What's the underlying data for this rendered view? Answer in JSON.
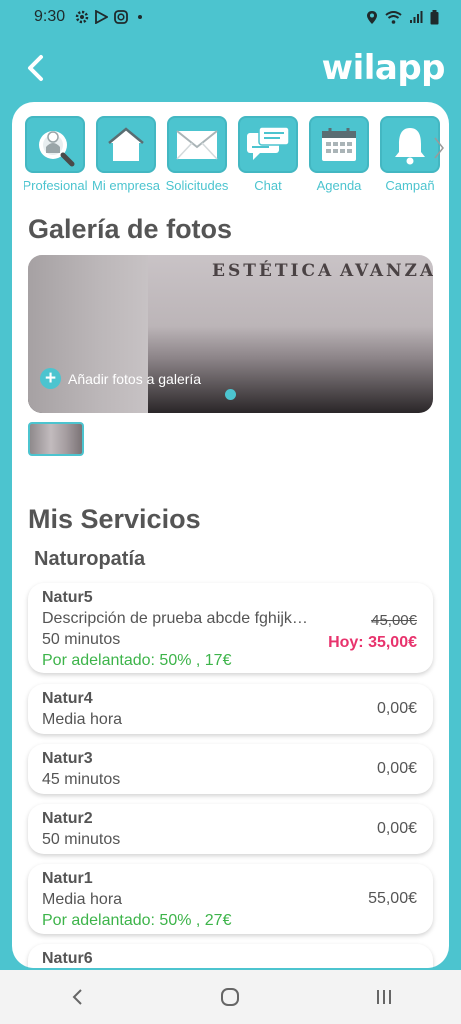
{
  "status_bar": {
    "time": "9:30"
  },
  "header": {
    "logo": "wilapp"
  },
  "menu": {
    "items": [
      {
        "label": "Profesional",
        "icon": "professional-search-icon"
      },
      {
        "label": "Mi empresa",
        "icon": "home-icon"
      },
      {
        "label": "Solicitudes",
        "icon": "envelope-icon"
      },
      {
        "label": "Chat",
        "icon": "chat-bubbles-icon"
      },
      {
        "label": "Agenda",
        "icon": "calendar-icon"
      },
      {
        "label": "Campañ",
        "icon": "bell-icon"
      }
    ]
  },
  "gallery": {
    "title": "Galería de fotos",
    "add_label": "Añadir fotos a galería",
    "photo_sign": "ESTÉTICA",
    "photo_sign2": "AVANZAD"
  },
  "services": {
    "title": "Mis Servicios",
    "category": "Naturopatía",
    "items": [
      {
        "name": "Natur5",
        "description": "Descripción de prueba abcde fghijk…",
        "duration": "50 minutos",
        "advance": "Por adelantado: 50% , 17€",
        "old_price": "45,00€",
        "today_price": "Hoy: 35,00€"
      },
      {
        "name": "Natur4",
        "duration": "Media hora",
        "price": "0,00€"
      },
      {
        "name": "Natur3",
        "duration": "45 minutos",
        "price": "0,00€"
      },
      {
        "name": "Natur2",
        "duration": "50 minutos",
        "price": "0,00€"
      },
      {
        "name": "Natur1",
        "duration": "Media hora",
        "advance": "Por adelantado: 50% , 27€",
        "price": "55,00€"
      },
      {
        "name": "Natur6"
      }
    ]
  },
  "colors": {
    "accent": "#4cc4cf",
    "advance_green": "#3db44a",
    "discount_pink": "#e8336d"
  }
}
